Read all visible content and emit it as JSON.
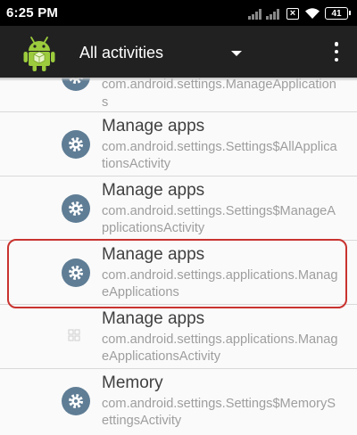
{
  "status_bar": {
    "time": "6:25 PM",
    "notification_badge": "×",
    "battery": "41"
  },
  "app_bar": {
    "title": "All activities",
    "app_icon": "android-robot-icon",
    "menu_icon": "overflow-menu-icon",
    "dropdown_icon": "dropdown-arrow-icon"
  },
  "list": {
    "items": [
      {
        "icon": "gear-icon",
        "subtitle_line1": "com.android.settings.ManageApplication",
        "subtitle_line2": "s"
      },
      {
        "icon": "gear-icon",
        "title": "Manage apps",
        "subtitle_line1": "com.android.settings.Settings$AllApplica",
        "subtitle_line2": "tionsActivity"
      },
      {
        "icon": "gear-icon",
        "title": "Manage apps",
        "subtitle_line1": "com.android.settings.Settings$ManageA",
        "subtitle_line2": "pplicationsActivity"
      },
      {
        "icon": "gear-icon",
        "title": "Manage apps",
        "subtitle_line1": "com.android.settings.applications.Manag",
        "subtitle_line2": "eApplications",
        "highlighted": true,
        "highlight_color": "#c9332f"
      },
      {
        "icon": "grid-icon",
        "title": "Manage apps",
        "subtitle_line1": "com.android.settings.applications.Manag",
        "subtitle_line2": "eApplicationsActivity"
      },
      {
        "icon": "gear-icon",
        "title": "Memory",
        "subtitle_line1": "com.android.settings.Settings$MemoryS",
        "subtitle_line2": "ettingsActivity"
      }
    ]
  },
  "colors": {
    "app_bar": "#212121",
    "status_bar": "#000000",
    "icon_circle": "#5f7d95",
    "title_text": "#404040",
    "subtitle_text": "#9e9e9e"
  }
}
